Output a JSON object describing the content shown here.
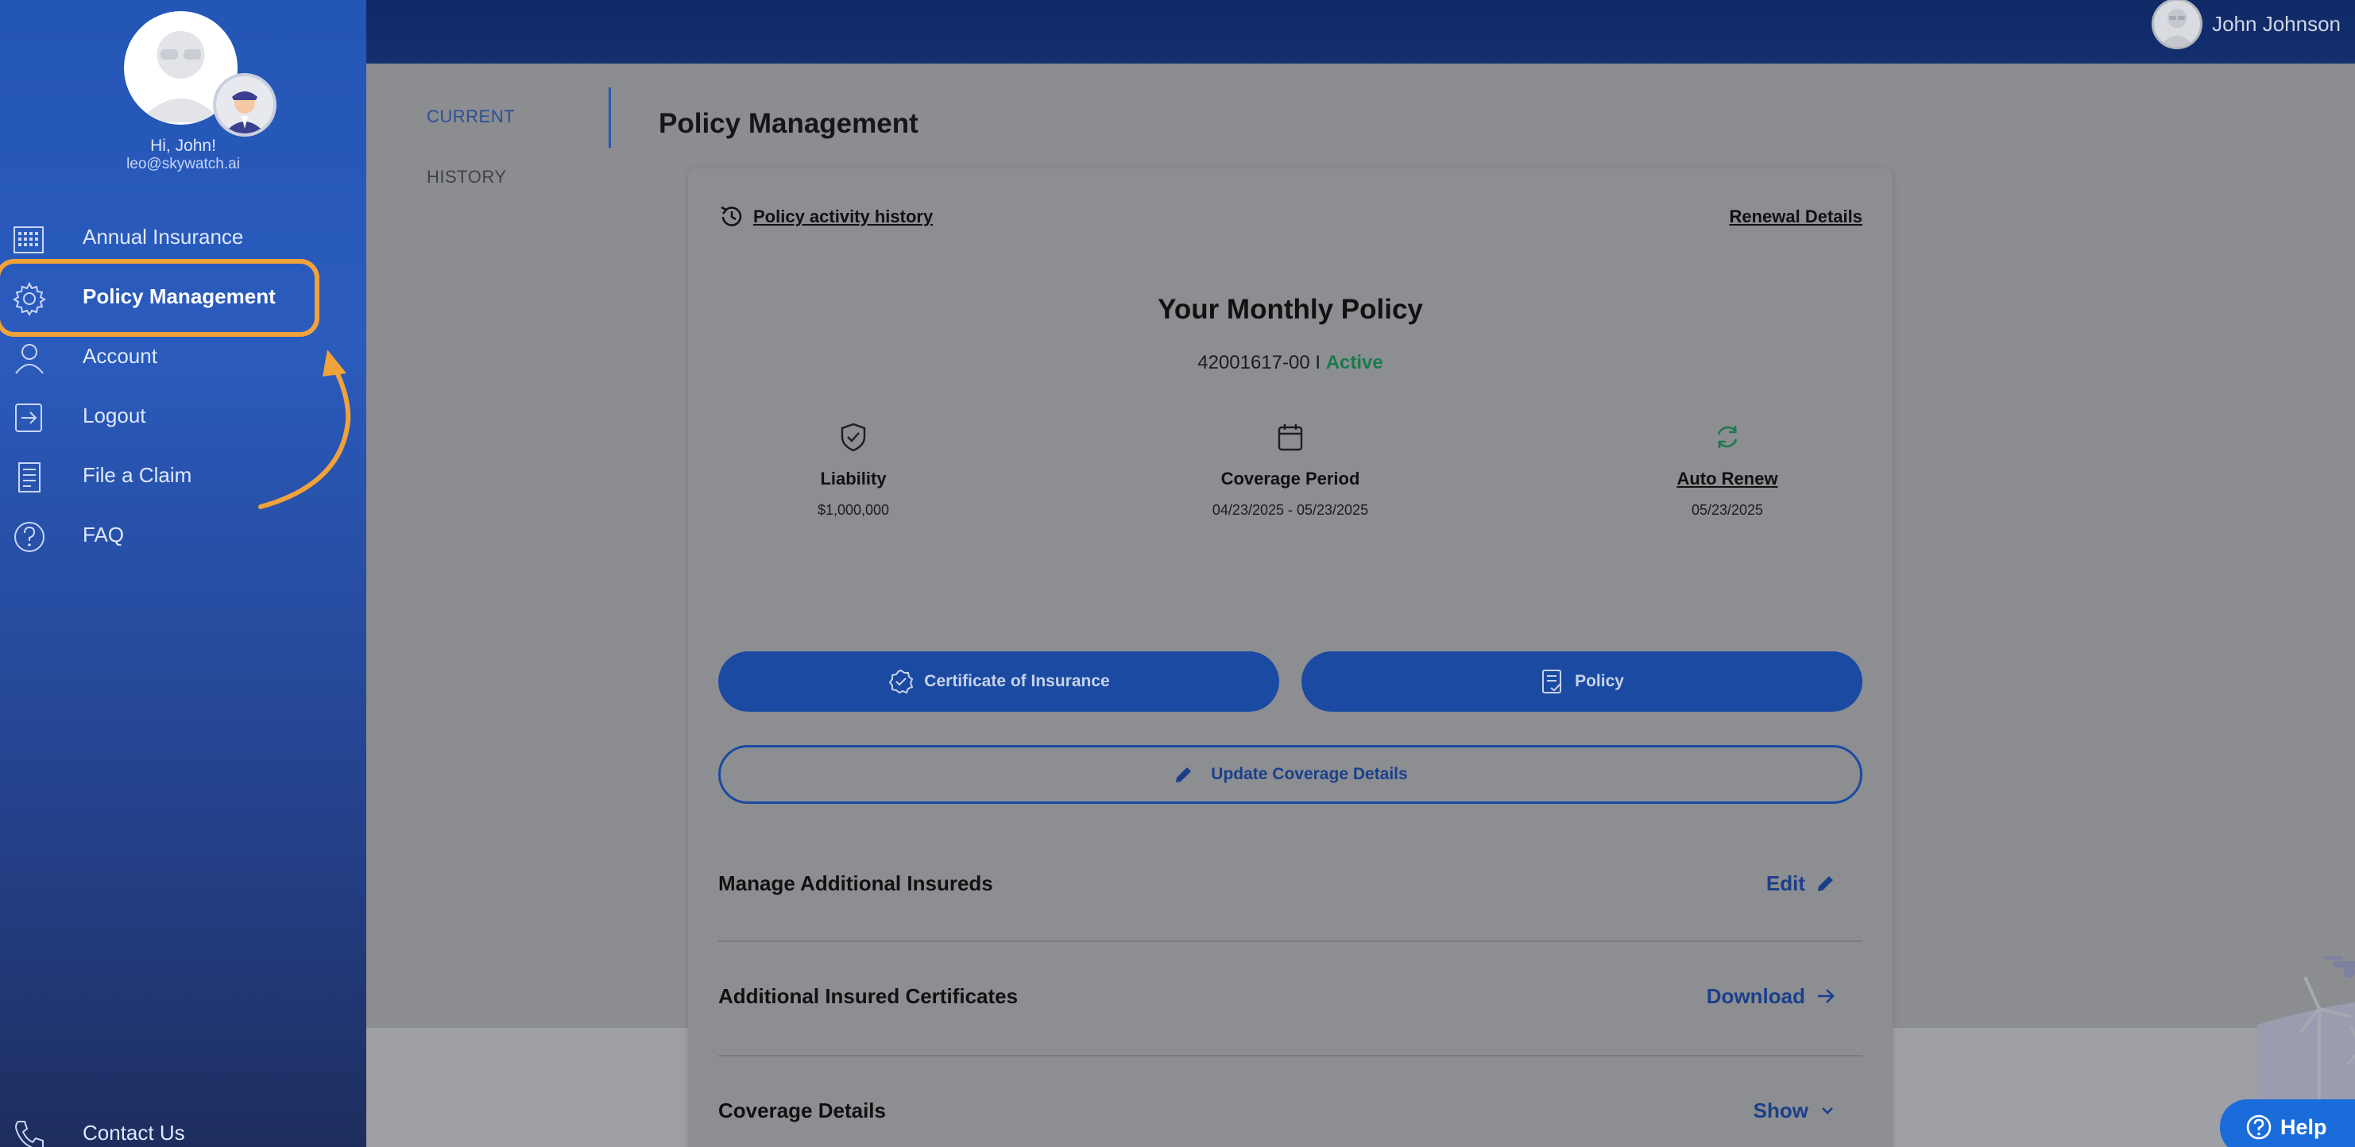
{
  "user": {
    "greeting": "Hi, John!",
    "email": "leo@skywatch.ai",
    "display_name": "John Johnson"
  },
  "sidebar": {
    "items": [
      {
        "label": "Annual Insurance",
        "icon": "calendar-grid-icon"
      },
      {
        "label": "Policy Management",
        "icon": "gear-icon",
        "active": true
      },
      {
        "label": "Account",
        "icon": "person-icon"
      },
      {
        "label": "Logout",
        "icon": "logout-icon"
      },
      {
        "label": "File a Claim",
        "icon": "document-icon"
      },
      {
        "label": "FAQ",
        "icon": "question-icon"
      }
    ],
    "contact_label": "Contact Us"
  },
  "tabs": {
    "current": "CURRENT",
    "history": "HISTORY"
  },
  "page_title": "Policy Management",
  "card": {
    "history_link": "Policy activity history",
    "renewal_link": "Renewal Details",
    "heading": "Your Monthly Policy",
    "policy_number": "42001617-00 I",
    "status": "Active",
    "stats": [
      {
        "label": "Liability",
        "value": "$1,000,000",
        "icon": "shield-check-icon"
      },
      {
        "label": "Coverage Period",
        "value": "04/23/2025 - 05/23/2025",
        "icon": "calendar-icon"
      },
      {
        "label": "Auto Renew",
        "value": "05/23/2025",
        "icon": "refresh-icon"
      }
    ],
    "certificate_button": "Certificate of Insurance",
    "policy_button": "Policy",
    "update_button": "Update Coverage Details",
    "rows": [
      {
        "label": "Manage Additional Insureds",
        "action": "Edit"
      },
      {
        "label": "Additional Insured Certificates",
        "action": "Download"
      },
      {
        "label": "Coverage Details",
        "action": "Show"
      }
    ]
  },
  "help_label": "Help",
  "colors": {
    "sidebar_top": "#2456b6",
    "sidebar_bottom": "#1d2d5e",
    "highlight": "#f2a23a",
    "primary": "#1a4aa2",
    "status_active": "#1b7a4d"
  }
}
